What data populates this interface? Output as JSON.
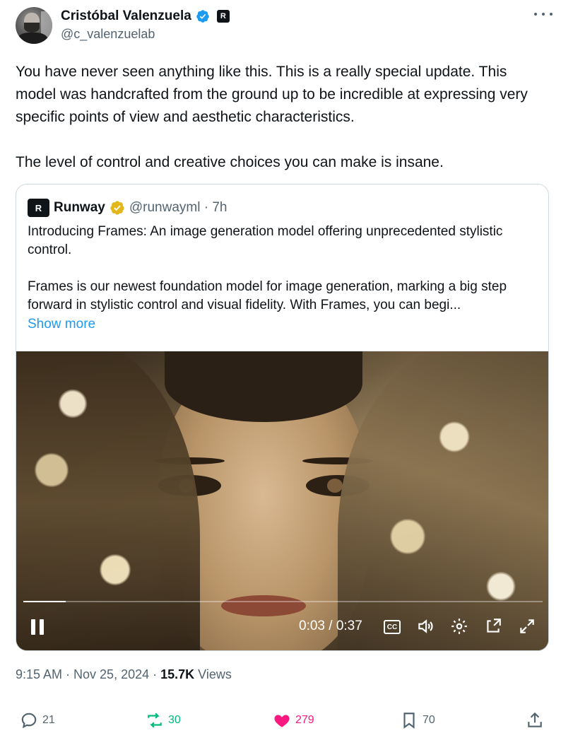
{
  "author": {
    "display_name": "Cristóbal Valenzuela",
    "handle": "@c_valenzuelab",
    "badge_letter": "R"
  },
  "tweet": {
    "paragraph1": "You have never seen anything like this. This is a really special update. This model was handcrafted from the ground up to be incredible at expressing very specific points of view and aesthetic characteristics.",
    "paragraph2": "The level of control and creative choices you can make is insane."
  },
  "quote": {
    "name": "Runway",
    "handle_time": "@runwayml · 7h",
    "paragraph1": "Introducing Frames: An image generation model offering unprecedented stylistic control.",
    "paragraph2": "Frames is our newest foundation model for image generation, marking a big step forward in stylistic control and visual fidelity. With Frames, you can begi...",
    "show_more": "Show more",
    "logo_letter": "R"
  },
  "video": {
    "time": "0:03 / 0:37",
    "cc_label": "CC",
    "progress": 0.081
  },
  "meta": {
    "time_date": "9:15 AM · Nov 25, 2024 · ",
    "views_count": "15.7K",
    "views_label": " Views"
  },
  "actions": {
    "replies": "21",
    "reposts": "30",
    "likes": "279",
    "bookmarks": "70"
  },
  "colors": {
    "link": "#1d9bf0",
    "muted": "#536471",
    "repost": "#00ba7c",
    "like": "#f91880",
    "verified_blue": "#1d9bf0",
    "verified_gold": "#e2b719"
  }
}
